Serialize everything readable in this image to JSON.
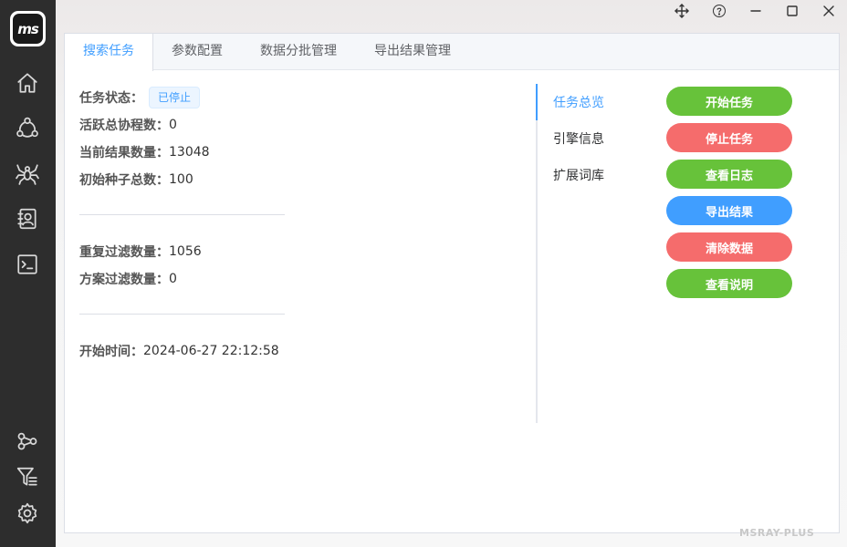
{
  "app": {
    "logo_text": "ms",
    "watermark": "MSRAY-PLUS"
  },
  "sidebar": {
    "items": [
      {
        "icon": "home-icon"
      },
      {
        "icon": "network-icon"
      },
      {
        "icon": "spider-icon"
      },
      {
        "icon": "contacts-icon"
      },
      {
        "icon": "terminal-icon"
      },
      {
        "icon": "share-nodes-icon"
      },
      {
        "icon": "filter-icon"
      },
      {
        "icon": "gear-icon"
      }
    ]
  },
  "window_controls": [
    "move-icon",
    "help-icon",
    "minimize-icon",
    "maximize-icon",
    "close-icon"
  ],
  "tabs": [
    {
      "label": "搜索任务",
      "active": true
    },
    {
      "label": "参数配置",
      "active": false
    },
    {
      "label": "数据分批管理",
      "active": false
    },
    {
      "label": "导出结果管理",
      "active": false
    }
  ],
  "stats": {
    "task_status": {
      "label": "任务状态：",
      "value": "已停止"
    },
    "active_coroutines": {
      "label": "活跃总协程数：",
      "value": "0"
    },
    "current_results": {
      "label": "当前结果数量：",
      "value": "13048"
    },
    "initial_seeds": {
      "label": "初始种子总数：",
      "value": "100"
    },
    "dup_filtered": {
      "label": "重复过滤数量：",
      "value": "1056"
    },
    "plan_filtered": {
      "label": "方案过滤数量：",
      "value": "0"
    },
    "start_time": {
      "label": "开始时间：",
      "value": "2024-06-27 22:12:58"
    }
  },
  "side_tabs": [
    {
      "label": "任务总览",
      "active": true
    },
    {
      "label": "引擎信息",
      "active": false
    },
    {
      "label": "扩展词库",
      "active": false
    }
  ],
  "actions": [
    {
      "label": "开始任务",
      "color": "#67c23a"
    },
    {
      "label": "停止任务",
      "color": "#f56c6c"
    },
    {
      "label": "查看日志",
      "color": "#67c23a"
    },
    {
      "label": "导出结果",
      "color": "#409eff"
    },
    {
      "label": "清除数据",
      "color": "#f56c6c"
    },
    {
      "label": "查看说明",
      "color": "#67c23a"
    }
  ],
  "colors": {
    "primary": "#409eff",
    "success": "#67c23a",
    "danger": "#f56c6c",
    "sidebar_bg": "#2d2d2d"
  }
}
